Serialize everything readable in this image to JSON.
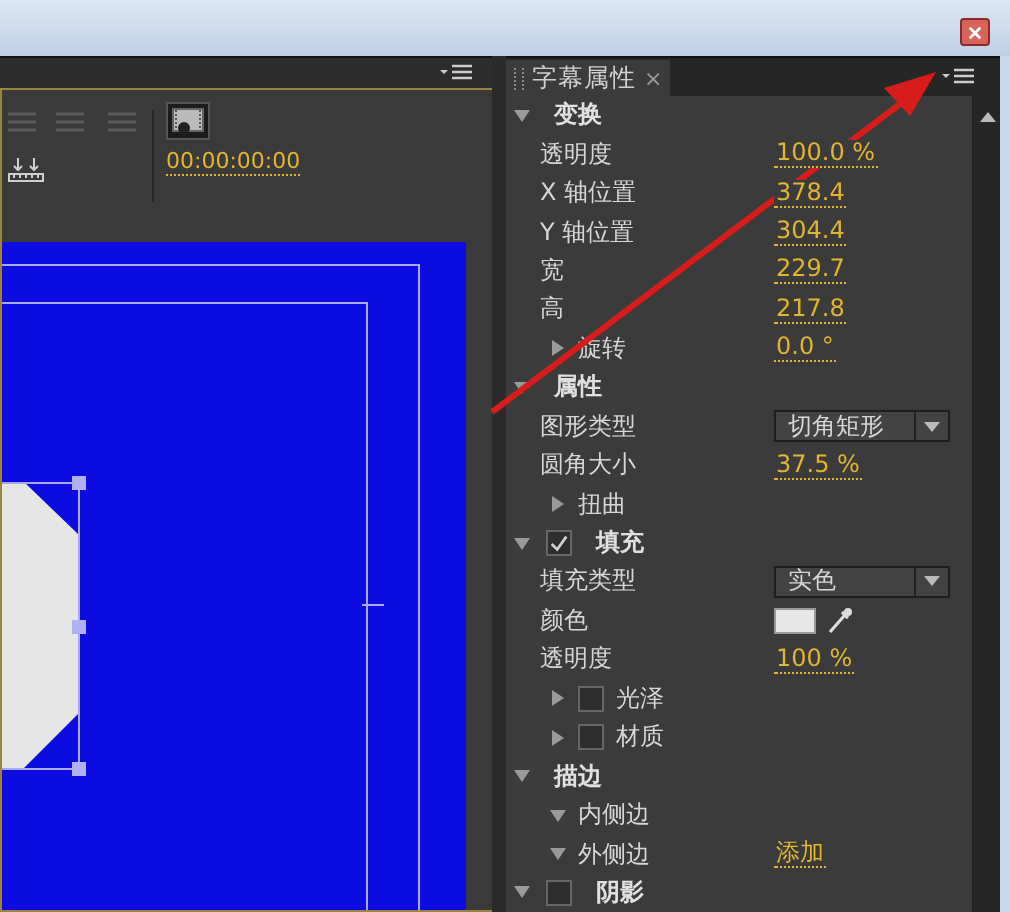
{
  "left_panel": {
    "timecode": "00:00:00:00"
  },
  "properties_panel": {
    "tab": {
      "label": "字幕属性",
      "selected": true,
      "close": "×"
    },
    "sections": [
      {
        "label": "变换",
        "expanded": true,
        "items": [
          {
            "kind": "value",
            "label": "透明度",
            "value": "100.0 %"
          },
          {
            "kind": "value",
            "label": "X 轴位置",
            "value": "378.4"
          },
          {
            "kind": "value",
            "label": "Y 轴位置",
            "value": "304.4"
          },
          {
            "kind": "value",
            "label": "宽",
            "value": "229.7"
          },
          {
            "kind": "value",
            "label": "高",
            "value": "217.8"
          },
          {
            "kind": "group",
            "label": "旋转",
            "expanded": false,
            "value": "0.0 °"
          }
        ]
      },
      {
        "label": "属性",
        "expanded": true,
        "items": [
          {
            "kind": "dropdown",
            "label": "图形类型",
            "value": "切角矩形"
          },
          {
            "kind": "value",
            "label": "圆角大小",
            "value": "37.5 %"
          },
          {
            "kind": "group",
            "label": "扭曲",
            "expanded": false
          }
        ]
      },
      {
        "label": "填充",
        "expanded": true,
        "checked": true,
        "items": [
          {
            "kind": "dropdown",
            "label": "填充类型",
            "value": "实色"
          },
          {
            "kind": "color",
            "label": "颜色",
            "color": "#e8e8e8"
          },
          {
            "kind": "value",
            "label": "透明度",
            "value": "100 %"
          },
          {
            "kind": "group",
            "label": "光泽",
            "expanded": false,
            "checked": false
          },
          {
            "kind": "group",
            "label": "材质",
            "expanded": false,
            "checked": false
          }
        ]
      },
      {
        "label": "描边",
        "expanded": true,
        "items": [
          {
            "kind": "group",
            "label": "内侧边",
            "expanded": true
          },
          {
            "kind": "group",
            "label": "外侧边",
            "expanded": true,
            "value": "添加"
          }
        ]
      },
      {
        "label": "阴影",
        "expanded": true,
        "checked": false
      }
    ]
  }
}
